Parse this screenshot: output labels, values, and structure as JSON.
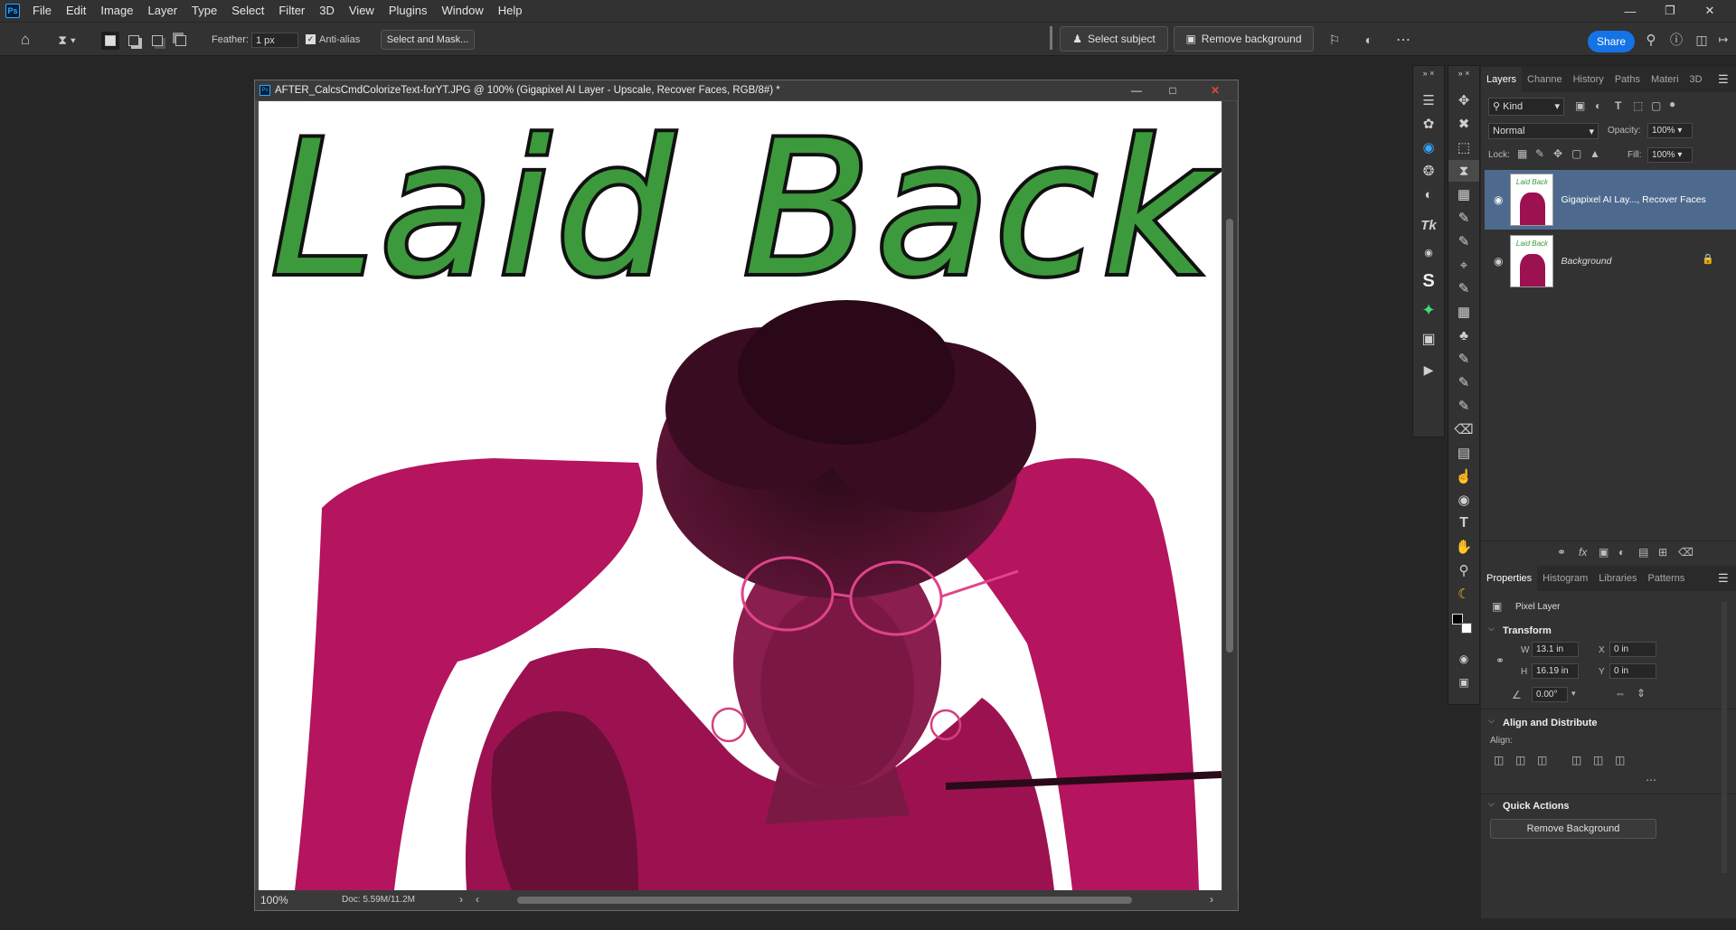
{
  "app": {
    "logo_text": "Ps"
  },
  "menu": [
    "File",
    "Edit",
    "Image",
    "Layer",
    "Type",
    "Select",
    "Filter",
    "3D",
    "View",
    "Plugins",
    "Window",
    "Help"
  ],
  "options": {
    "feather_label": "Feather:",
    "feather_value": "1 px",
    "antialias_label": "Anti-alias",
    "select_mask": "Select and Mask...",
    "select_subject": "Select subject",
    "remove_background": "Remove background",
    "share": "Share"
  },
  "document": {
    "title": "AFTER_CalcsCmdColorizeText-forYT.JPG @ 100% (Gigapixel AI Layer - Upscale, Recover Faces, RGB/8#) *",
    "zoom": "100%",
    "doc_size": "Doc: 5.59M/11.2M",
    "canvas_text": "Laid Back"
  },
  "layers_panel": {
    "tabs": [
      "Layers",
      "Channe",
      "History",
      "Paths",
      "Materi",
      "3D"
    ],
    "kind_label": "Kind",
    "blend_mode": "Normal",
    "opacity_label": "Opacity:",
    "opacity_value": "100%",
    "lock_label": "Lock:",
    "fill_label": "Fill:",
    "fill_value": "100%",
    "layers": [
      {
        "name": "Gigapixel AI Lay..., Recover Faces",
        "selected": true
      },
      {
        "name": "Background",
        "selected": false
      }
    ]
  },
  "properties_panel": {
    "tabs": [
      "Properties",
      "Histogram",
      "Libraries",
      "Patterns"
    ],
    "layer_type": "Pixel Layer",
    "transform_title": "Transform",
    "w_label": "W",
    "w_value": "13.1 in",
    "h_label": "H",
    "h_value": "16.19 in",
    "x_label": "X",
    "x_value": "0 in",
    "y_label": "Y",
    "y_value": "0 in",
    "angle_value": "0.00°",
    "align_title": "Align and Distribute",
    "align_label": "Align:",
    "quick_actions_title": "Quick Actions",
    "remove_bg_button": "Remove Background"
  },
  "colors": {
    "accent": "#1473e6",
    "text_green": "#3a9a3a",
    "magenta": "#c2185b"
  }
}
